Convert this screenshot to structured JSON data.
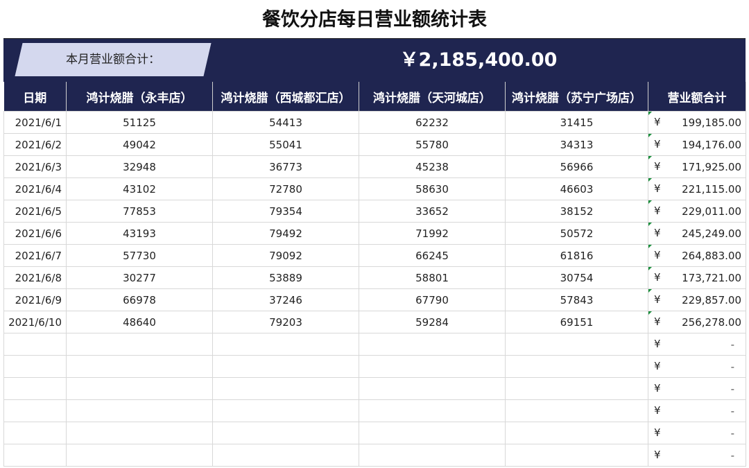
{
  "title": "餐饮分店每日营业额统计表",
  "summary": {
    "label": "本月营业额合计：",
    "total": "￥2,185,400.00"
  },
  "headers": [
    "日期",
    "鸿计烧腊（永丰店）",
    "鸿计烧腊（西城都汇店）",
    "鸿计烧腊（天河城店）",
    "鸿计烧腊（苏宁广场店）",
    "营业额合计"
  ],
  "currency_symbol": "¥",
  "rows": [
    [
      "2021/6/1",
      "51125",
      "54413",
      "62232",
      "31415",
      "199,185.00"
    ],
    [
      "2021/6/2",
      "49042",
      "55041",
      "55780",
      "34313",
      "194,176.00"
    ],
    [
      "2021/6/3",
      "32948",
      "36773",
      "45238",
      "56966",
      "171,925.00"
    ],
    [
      "2021/6/4",
      "43102",
      "72780",
      "58630",
      "46603",
      "221,115.00"
    ],
    [
      "2021/6/5",
      "77853",
      "79354",
      "33652",
      "38152",
      "229,011.00"
    ],
    [
      "2021/6/6",
      "43193",
      "79492",
      "71992",
      "50572",
      "245,249.00"
    ],
    [
      "2021/6/7",
      "57730",
      "79092",
      "66245",
      "61816",
      "264,883.00"
    ],
    [
      "2021/6/8",
      "30277",
      "53889",
      "58801",
      "30754",
      "173,721.00"
    ],
    [
      "2021/6/9",
      "66978",
      "37246",
      "67790",
      "57843",
      "229,857.00"
    ],
    [
      "2021/6/10",
      "48640",
      "79203",
      "59284",
      "69151",
      "256,278.00"
    ],
    [
      "",
      "",
      "",
      "",
      "",
      "-"
    ],
    [
      "",
      "",
      "",
      "",
      "",
      "-"
    ],
    [
      "",
      "",
      "",
      "",
      "",
      "-"
    ],
    [
      "",
      "",
      "",
      "",
      "",
      "-"
    ],
    [
      "",
      "",
      "",
      "",
      "",
      "-"
    ],
    [
      "",
      "",
      "",
      "",
      "",
      "-"
    ]
  ],
  "colors": {
    "header_bg": "#1f2550",
    "label_bg": "#d4d8ee",
    "cell_marker": "#1a8f3c"
  }
}
